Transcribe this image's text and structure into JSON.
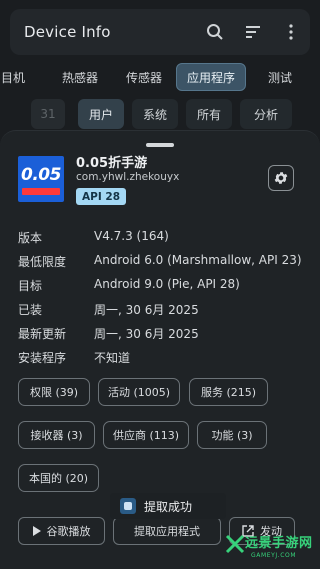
{
  "header": {
    "title": "Device Info",
    "icons": [
      "search-icon",
      "sort-icon",
      "more-vert-icon"
    ]
  },
  "tabs": [
    {
      "label": "相机",
      "clipped_label": "目机",
      "active": false
    },
    {
      "label": "传感器",
      "clipped_label": "热感器",
      "active": false
    },
    {
      "label": "传感器",
      "active": false
    },
    {
      "label": "应用程序",
      "active": true
    },
    {
      "label": "测试",
      "active": false
    }
  ],
  "filters": {
    "count": "31",
    "items": [
      "用户",
      "系统",
      "所有",
      "分析"
    ],
    "active": "用户"
  },
  "app": {
    "name": "0.05折手游",
    "package": "com.yhwl.zhekouyx",
    "api_badge": "API 28",
    "logo_text": "0.05",
    "logo_icon": "app-logo-icon"
  },
  "details": [
    {
      "key": "版本",
      "value": "V4.7.3 (164)"
    },
    {
      "key": "最低限度",
      "value": "Android 6.0 (Marshmallow, API 23)"
    },
    {
      "key": "目标",
      "value": "Android 9.0 (Pie, API 28)"
    },
    {
      "key": "已装",
      "value": "周一, 30 6月 2025"
    },
    {
      "key": "最新更新",
      "value": "周一, 30 6月 2025"
    },
    {
      "key": "安装程序",
      "value": "不知道"
    }
  ],
  "pills": [
    "权限 (39)",
    "活动 (1005)",
    "服务 (215)",
    "接收器 (3)",
    "供应商 (113)",
    "功能 (3)",
    "本国的 (20)"
  ],
  "actions": {
    "play_store": "谷歌播放",
    "extract": "提取应用程式",
    "launch": "发动"
  },
  "toast": "提取成功",
  "watermark": {
    "text": "远景手游网",
    "sub": "GAMEYJ.COM"
  },
  "colors": {
    "background": "#1a1d20",
    "sheet": "#1f2326",
    "active_tab": "#3c5466",
    "badge": "#a4d8f4",
    "watermark": "#37d27b"
  }
}
